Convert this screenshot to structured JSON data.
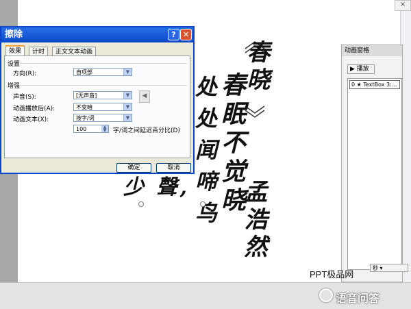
{
  "dialog": {
    "title": "擦除",
    "help_label": "?",
    "close_label": "✕",
    "tabs": [
      "效果",
      "计时",
      "正文文本动画"
    ],
    "settings_label": "设置",
    "direction_label": "方向(R):",
    "direction_value": "自项部",
    "enhance_label": "增强",
    "sound_label": "声音(S):",
    "sound_value": "[无声音]",
    "after_label": "动画播放后(A):",
    "after_value": "不变暗",
    "text_label": "动画文本(X):",
    "text_value": "按字/词",
    "delay_value": "100",
    "delay_suffix": "字/词之间延迟百分比(D)",
    "ok_label": "确定",
    "cancel_label": "取消"
  },
  "pane": {
    "title": "动画窗格",
    "play_label": "▶ 播放",
    "item_label": "0 ★ TextBox 3:...",
    "seconds_label": "秒 ▾"
  },
  "slide": {
    "line1": "春晓",
    "line2": "春眠不觉晓",
    "line3": "处处闻啼鸟",
    "line4": "孟浩然",
    "line5": "少 聲,"
  },
  "watermark": {
    "site": "PPT极品网",
    "brand": "语音问答"
  },
  "colors": {
    "title_bar": "#0a48c8",
    "dialog_bg": "#ece9d8",
    "tab_highlight": "#f3a437"
  }
}
